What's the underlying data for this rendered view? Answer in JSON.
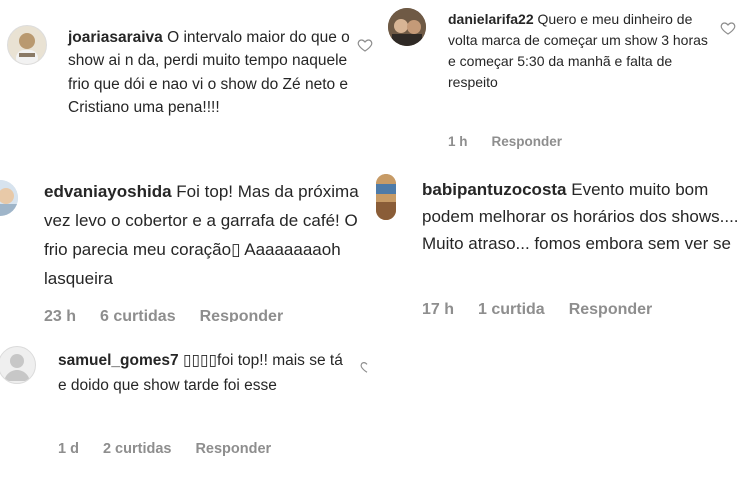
{
  "comments": [
    {
      "username": "joariasaraiva",
      "text": "O intervalo maior do que o show ai n da, perdi muito tempo naquele frio que dói e nao vi o show do Zé neto e Cristiano uma pena!!!!"
    },
    {
      "username": "danielarifa22",
      "text": "Quero e meu dinheiro de volta marca de começar um show 3 horas e começar 5:30 da manhã e falta de respeito",
      "time": "1 h",
      "reply": "Responder"
    },
    {
      "username": "edvaniayoshida",
      "text": "Foi top! Mas da próxima vez levo o cobertor e a garrafa de café! O frio parecia meu coração▯ Aaaaaaaaoh lasqueira",
      "time": "23 h",
      "likes": "6 curtidas",
      "reply": "Responder"
    },
    {
      "username": "babipantuzocosta",
      "text": "Evento muito bom podem melhorar os horários dos shows.... Muito atraso... fomos embora sem ver se",
      "time": "17 h",
      "likes": "1 curtida",
      "reply": "Responder"
    },
    {
      "username": "samuel_gomes7",
      "text": "▯▯▯▯foi top!! mais se tá e doido que show tarde foi esse",
      "time": "1 d",
      "likes": "2 curtidas",
      "reply": "Responder"
    }
  ],
  "icons": {
    "like": "heart-icon"
  },
  "colors": {
    "text": "#262626",
    "meta": "#8e8e8e"
  }
}
